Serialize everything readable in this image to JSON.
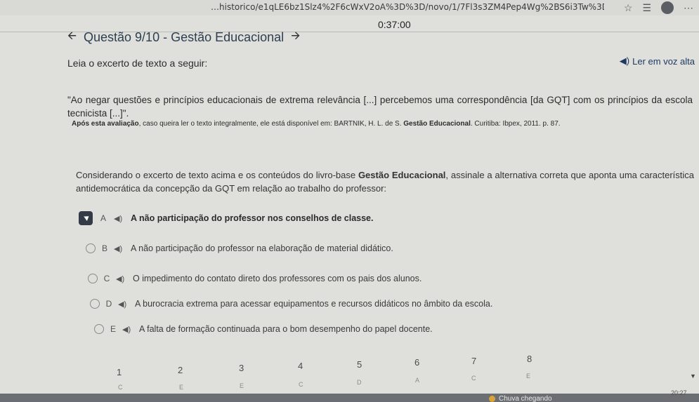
{
  "browser": {
    "url": "…historico/e1qLE6bz1Slz4%2F6cWxV2oA%3D%3D/novo/1/7Fl3s3ZM4Pep4Wg%2BS6i3Tw%3D%3D"
  },
  "exam": {
    "timer": "0:37:00",
    "title": "Questão 9/10 - Gestão Educacional",
    "read_aloud": "Ler em voz alta",
    "intro": "Leia o excerto de texto a seguir:",
    "quote": "\"Ao negar questões e princípios educacionais de extrema relevância [...] percebemos uma correspondência [da GQT] com os princípios da escola tecnicista [...]\".",
    "source_bold": "Após esta avaliação",
    "source_rest": ", caso queira ler o texto integralmente, ele está disponível em: BARTNIK, H. L. de S. ",
    "source_book": "Gestão Educacional",
    "source_tail": ". Curitiba: Ibpex, 2011. p. 87.",
    "prompt_start": "Considerando o excerto de texto acima e os conteúdos do livro-base ",
    "prompt_bold": "Gestão Educacional",
    "prompt_end": ", assinale a alternativa correta que aponta uma característica antidemocrática da concepção da GQT em relação ao trabalho do professor:",
    "options": [
      {
        "letter": "A",
        "text": "A não participação do professor nos conselhos de classe."
      },
      {
        "letter": "B",
        "text": "A não participação do professor na elaboração de material didático."
      },
      {
        "letter": "C",
        "text": "O impedimento do contato direto dos professores com os pais dos alunos."
      },
      {
        "letter": "D",
        "text": "A burocracia extrema para acessar equipamentos e recursos didáticos no âmbito da escola."
      },
      {
        "letter": "E",
        "text": "A falta de formação continuada para o bom desempenho do papel docente."
      }
    ],
    "navigation": [
      {
        "number": "1",
        "answer": "C"
      },
      {
        "number": "2",
        "answer": "E"
      },
      {
        "number": "3",
        "answer": "E"
      },
      {
        "number": "4",
        "answer": "C"
      },
      {
        "number": "5",
        "answer": "D"
      },
      {
        "number": "6",
        "answer": "A"
      },
      {
        "number": "7",
        "answer": "C"
      },
      {
        "number": "8",
        "answer": "E"
      }
    ]
  },
  "taskbar": {
    "weather": "Chuva chegando",
    "clock": "20:27"
  },
  "icons": {
    "back": "arrow-left-icon",
    "forward": "arrow-right-icon",
    "speaker": "speaker-icon"
  }
}
